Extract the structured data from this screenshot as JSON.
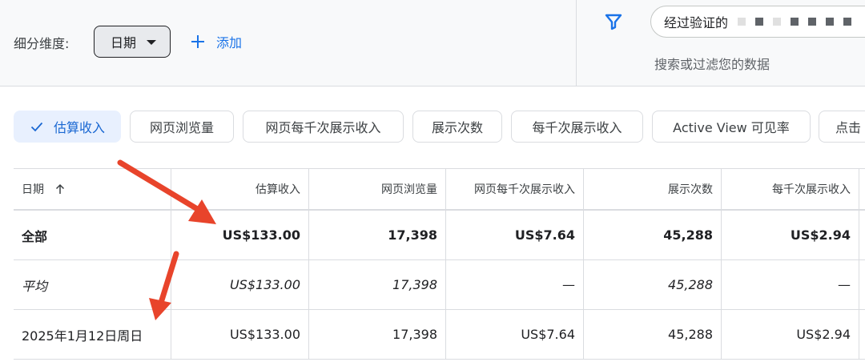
{
  "toolbar": {
    "dimension_label": "细分维度:",
    "dimension_value": "日期",
    "add_label": "添加"
  },
  "filter": {
    "search_value": "经过验证的",
    "search_hint": "搜索或过滤您的数据"
  },
  "metrics": [
    {
      "label": "估算收入",
      "selected": true
    },
    {
      "label": "网页浏览量",
      "selected": false
    },
    {
      "label": "网页每千次展示收入",
      "selected": false
    },
    {
      "label": "展示次数",
      "selected": false
    },
    {
      "label": "每千次展示收入",
      "selected": false
    },
    {
      "label": "Active View 可见率",
      "selected": false
    },
    {
      "label": "点击",
      "selected": false
    }
  ],
  "table": {
    "headers": [
      "日期",
      "估算收入",
      "网页浏览量",
      "网页每千次展示收入",
      "展示次数",
      "每千次展示收入"
    ],
    "rows": [
      [
        "全部",
        "US$133.00",
        "17,398",
        "US$7.64",
        "45,288",
        "US$2.94"
      ],
      [
        "平均",
        "US$133.00",
        "17,398",
        "—",
        "45,288",
        "—"
      ],
      [
        "2025年1月12日周日",
        "US$133.00",
        "17,398",
        "US$7.64",
        "45,288",
        "US$2.94"
      ]
    ]
  },
  "colors": {
    "accent": "#1a73e8",
    "active_chip_bg": "#e8f0fe",
    "annotation_arrow": "#e8442b"
  },
  "icons": {
    "filter": "filter-icon",
    "check": "check-icon",
    "sort": "arrow-up-icon",
    "dropdown": "caret-down-icon",
    "add": "plus-icon"
  }
}
